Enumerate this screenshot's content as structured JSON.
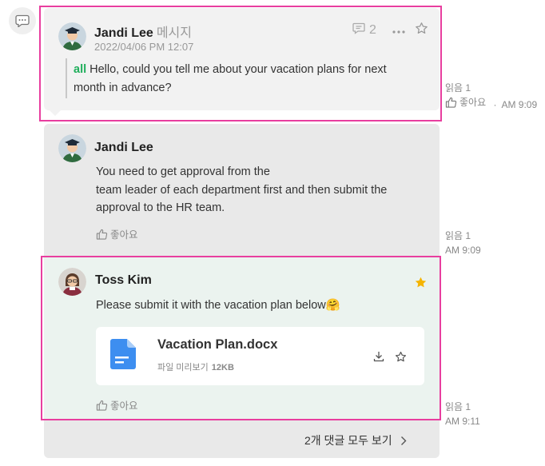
{
  "colors": {
    "highlight": "#e83e9f",
    "mention": "#1fae5b",
    "star": "#f5b400",
    "file_icon": "#3d8ef0"
  },
  "message": {
    "author": "Jandi Lee",
    "author_sub": "메시지",
    "date": "2022/04/06 PM 12:07",
    "mention": "all",
    "text_line1": "Hello, could you tell me about your vacation plans for next",
    "text_line2": "month in advance?",
    "comment_count": "2",
    "icons": [
      "comment-icon",
      "more-icon",
      "star-icon"
    ],
    "read_label": "읽음 1",
    "like_label": "좋아요",
    "separator": "·",
    "time": "AM 9:09"
  },
  "replies": [
    {
      "author": "Jandi Lee",
      "lines": [
        "You need to get approval from the",
        "team leader of each department first and then submit the",
        "approval to the HR team."
      ],
      "like_label": "좋아요",
      "read_label": "읽음 1",
      "time": "AM 9:09"
    },
    {
      "author": "Toss Kim",
      "text": "Please submit it with the vacation plan below🤗",
      "starred": true,
      "file": {
        "name": "Vacation Plan.docx",
        "preview_label": "파일 미리보기",
        "size": "12KB",
        "icons": [
          "download-icon",
          "star-icon"
        ]
      },
      "like_label": "좋아요",
      "read_label": "읽음 1",
      "time": "AM 9:11"
    }
  ],
  "view_all_comments": "2개 댓글 모두 보기"
}
